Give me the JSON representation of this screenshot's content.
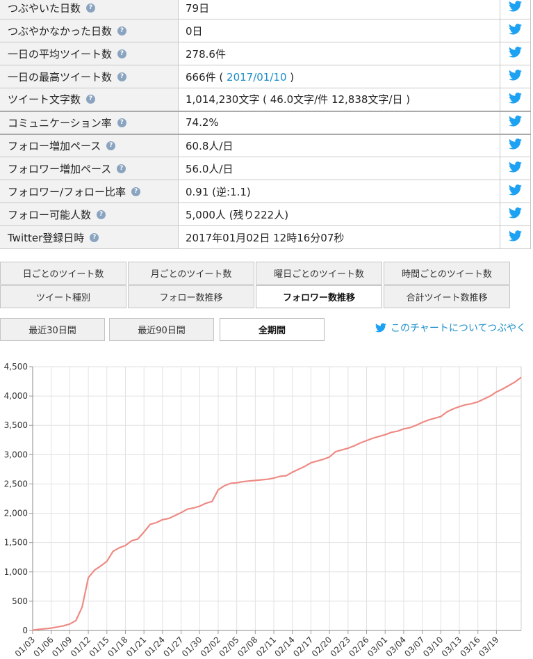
{
  "stats": [
    {
      "label": "つぶやいた日数",
      "value": "79日"
    },
    {
      "label": "つぶやかなかった日数",
      "value": "0日"
    },
    {
      "label": "一日の平均ツイート数",
      "value": "278.6件"
    },
    {
      "label": "一日の最高ツイート数",
      "value_prefix": "666件 ( ",
      "link": "2017/01/10",
      "value_suffix": " )"
    },
    {
      "label": "ツイート文字数",
      "value": "1,014,230文字 ( 46.0文字/件 12,838文字/日 )"
    },
    {
      "label": "コミュニケーション率",
      "value": "74.2%"
    },
    {
      "label": "フォロー増加ペース",
      "value": "60.8人/日"
    },
    {
      "label": "フォロワー増加ペース",
      "value": "56.0人/日"
    },
    {
      "label": "フォロワー/フォロー比率",
      "value": "0.91 (逆:1.1)"
    },
    {
      "label": "フォロー可能人数",
      "value": "5,000人 (残り222人)"
    },
    {
      "label": "Twitter登録日時",
      "value": "2017年01月02日 12時16分07秒"
    }
  ],
  "help_glyph": "?",
  "tabs_row1": [
    "日ごとのツイート数",
    "月ごとのツイート数",
    "曜日ごとのツイート数",
    "時間ごとのツイート数"
  ],
  "tabs_row2": [
    "ツイート種別",
    "フォロー数推移",
    "フォロワー数推移",
    "合計ツイート数推移"
  ],
  "active_tab": "フォロワー数推移",
  "periods": [
    "最近30日間",
    "最近90日間",
    "全期間"
  ],
  "active_period": "全期間",
  "chart_link": "このチャートについてつぶやく",
  "colors": {
    "twitter": "#1da1f2",
    "line": "#ee8a84",
    "link": "#1b8ec9"
  },
  "chart_data": {
    "type": "line",
    "title": "",
    "xlabel": "",
    "ylabel": "",
    "ylim": [
      0,
      4500
    ],
    "yticks": [
      0,
      500,
      1000,
      1500,
      2000,
      2500,
      3000,
      3500,
      4000,
      4500
    ],
    "ytick_labels": [
      "0",
      "500",
      "1,000",
      "1,500",
      "2,000",
      "2,500",
      "3,000",
      "3,500",
      "4,000",
      "4,500"
    ],
    "xtick_labels": [
      "01/03",
      "01/06",
      "01/09",
      "01/12",
      "01/15",
      "01/18",
      "01/21",
      "01/24",
      "01/27",
      "01/30",
      "02/02",
      "02/05",
      "02/08",
      "02/11",
      "02/14",
      "02/17",
      "02/20",
      "02/23",
      "02/26",
      "03/01",
      "03/04",
      "03/07",
      "03/10",
      "03/13",
      "03/16",
      "03/19"
    ],
    "x_start": "01/03",
    "grid": true,
    "series": [
      {
        "values": [
          5,
          20,
          30,
          40,
          60,
          80,
          110,
          170,
          400,
          900,
          1030,
          1100,
          1180,
          1350,
          1410,
          1450,
          1530,
          1560,
          1680,
          1810,
          1840,
          1890,
          1910,
          1960,
          2010,
          2070,
          2090,
          2120,
          2170,
          2200,
          2400,
          2470,
          2510,
          2520,
          2540,
          2550,
          2560,
          2570,
          2580,
          2600,
          2630,
          2640,
          2700,
          2750,
          2800,
          2860,
          2890,
          2920,
          2960,
          3050,
          3080,
          3110,
          3150,
          3200,
          3240,
          3280,
          3310,
          3340,
          3380,
          3400,
          3440,
          3460,
          3500,
          3550,
          3590,
          3620,
          3650,
          3730,
          3780,
          3820,
          3850,
          3870,
          3900,
          3950,
          4000,
          4070,
          4120,
          4180,
          4240,
          4320
        ]
      }
    ]
  }
}
